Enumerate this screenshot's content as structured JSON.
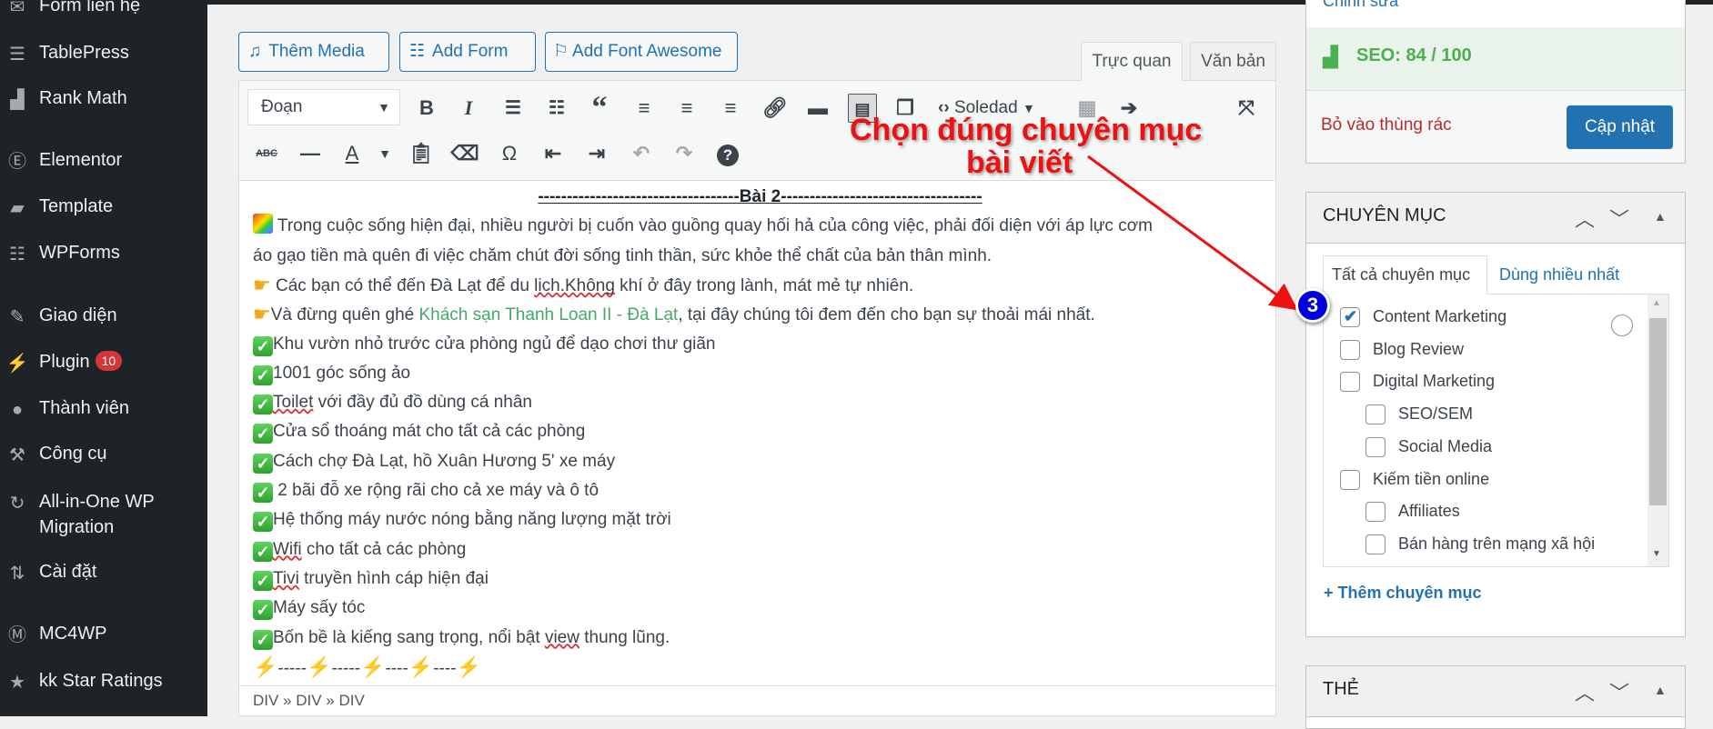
{
  "sidebar": {
    "items": [
      {
        "label": "Form liên hệ",
        "icon": "mail-icon"
      },
      {
        "label": "TablePress",
        "icon": "table-icon"
      },
      {
        "label": "Rank Math",
        "icon": "chart-icon"
      },
      {
        "label": "Elementor",
        "icon": "elementor-icon"
      },
      {
        "label": "Template",
        "icon": "folder-icon"
      },
      {
        "label": "WPForms",
        "icon": "form-icon"
      },
      {
        "label": "Giao diện",
        "icon": "brush-icon"
      },
      {
        "label": "Plugin",
        "icon": "plugin-icon",
        "badge": "10"
      },
      {
        "label": "Thành viên",
        "icon": "user-icon"
      },
      {
        "label": "Công cụ",
        "icon": "wrench-icon"
      },
      {
        "label": "All-in-One WP",
        "label2": "Migration",
        "icon": "migration-icon"
      },
      {
        "label": "Cài đặt",
        "icon": "settings-icon"
      },
      {
        "label": "MC4WP",
        "icon": "mc4wp-icon"
      },
      {
        "label": "kk Star Ratings",
        "icon": "star-icon"
      }
    ]
  },
  "media_buttons": {
    "add_media": "Thêm Media",
    "add_form": "Add Form",
    "add_font_awesome": "Add Font Awesome"
  },
  "editor_tabs": {
    "visual": "Trực quan",
    "text": "Văn bản"
  },
  "toolbar": {
    "format": "Đoạn",
    "soledad": "Soledad"
  },
  "content": {
    "lines": [
      {
        "style": "center",
        "parts": [
          {
            "t": "-----------------------------------Bài 2-----------------------------------"
          }
        ]
      },
      {
        "icon": "rainbow",
        "parts": [
          {
            "t": " Trong cuộc sống hiện đại, nhiều người bị cuốn vào guồng quay hối hả của công việc, phải đối diện với áp lực cơm"
          }
        ]
      },
      {
        "parts": [
          {
            "t": "áo gạo tiền mà quên đi việc chăm chút đời sống tinh thần, sức khỏe thể chất của bản thân mình."
          }
        ]
      },
      {
        "icon": "hand",
        "parts": [
          {
            "t": " Các bạn có thể đến Đà Lạt để du "
          },
          {
            "t": "lịch.Không",
            "sp": true
          },
          {
            "t": " khí ở đây trong lành, mát mẻ tự nhiên."
          }
        ]
      },
      {
        "icon": "hand",
        "parts": [
          {
            "t": "Và đừng quên ghé "
          },
          {
            "t": "Khách sạn Thanh Loan II - Đà Lạt",
            "link": true
          },
          {
            "t": ", tại đây chúng tôi đem đến cho bạn sự thoải mái nhất."
          }
        ]
      },
      {
        "icon": "check",
        "parts": [
          {
            "t": "Khu vườn nhỏ trước cửa phòng ngủ để dạo chơi thư giãn"
          }
        ]
      },
      {
        "icon": "check",
        "parts": [
          {
            "t": "1001 góc sống ảo"
          }
        ]
      },
      {
        "icon": "check",
        "parts": [
          {
            "t": "Toilet",
            "sp": true
          },
          {
            "t": " với đầy đủ đồ dùng cá nhân"
          }
        ]
      },
      {
        "icon": "check",
        "parts": [
          {
            "t": "Cửa sổ thoáng mát cho tất cả các phòng"
          }
        ]
      },
      {
        "icon": "check",
        "parts": [
          {
            "t": "Cách chợ Đà Lạt, hồ Xuân Hương 5' xe máy"
          }
        ]
      },
      {
        "icon": "check",
        "parts": [
          {
            "t": " 2 bãi đỗ xe rộng rãi cho cả xe máy và ô tô"
          }
        ]
      },
      {
        "icon": "check",
        "parts": [
          {
            "t": "Hệ thống máy nước nóng bằng năng lượng mặt trời"
          }
        ]
      },
      {
        "icon": "check",
        "parts": [
          {
            "t": "Wifi",
            "sp": true
          },
          {
            "t": " cho tất cả các phòng"
          }
        ]
      },
      {
        "icon": "check",
        "parts": [
          {
            "t": "Tivi",
            "sp": true
          },
          {
            "t": " truyền hình cáp hiện đại"
          }
        ]
      },
      {
        "icon": "check",
        "parts": [
          {
            "t": "Máy sấy tóc"
          }
        ]
      },
      {
        "icon": "check",
        "parts": [
          {
            "t": "Bốn bề là kiếng sang trọng, nổi bật "
          },
          {
            "t": "view",
            "sp": true
          },
          {
            "t": " thung lũng."
          }
        ]
      },
      {
        "parts": [
          {
            "t": "⚡",
            "bolt": true
          },
          {
            "t": "-----"
          },
          {
            "t": "⚡",
            "bolt": true
          },
          {
            "t": "-----"
          },
          {
            "t": "⚡",
            "bolt": true
          },
          {
            "t": "----"
          },
          {
            "t": "⚡",
            "bolt": true
          },
          {
            "t": "----"
          },
          {
            "t": "⚡",
            "bolt": true
          }
        ]
      }
    ]
  },
  "status_path": "DIV » DIV » DIV",
  "annotation": {
    "line1": "Chọn đúng chuyên mục",
    "line2": "bài viết",
    "step": "3",
    "color": "#ee1111"
  },
  "publish": {
    "edit_link": "Chỉnh sửa",
    "seo": "SEO: 84 / 100",
    "seo_score": 84,
    "trash": "Bỏ vào thùng rác",
    "update": "Cập nhật"
  },
  "categories": {
    "title": "CHUYÊN MỤC",
    "tab_all": "Tất cả chuyên mục",
    "tab_popular": "Dùng nhiều nhất",
    "items": [
      {
        "label": "Content Marketing",
        "checked": true,
        "level": 0
      },
      {
        "label": "Blog Review",
        "checked": false,
        "level": 0
      },
      {
        "label": "Digital Marketing",
        "checked": false,
        "level": 0
      },
      {
        "label": "SEO/SEM",
        "checked": false,
        "level": 1
      },
      {
        "label": "Social Media",
        "checked": false,
        "level": 1
      },
      {
        "label": "Kiếm tiền online",
        "checked": false,
        "level": 0
      },
      {
        "label": "Affiliates",
        "checked": false,
        "level": 1
      },
      {
        "label": "Bán hàng trên mạng xã hội",
        "checked": false,
        "level": 1
      }
    ],
    "add_link": "+ Thêm chuyên mục"
  },
  "tags": {
    "title": "THẺ"
  },
  "colors": {
    "primary": "#2271b1",
    "sidebar": "#1d2327",
    "seo_green": "#4caf50",
    "trash": "#b32d2e"
  }
}
